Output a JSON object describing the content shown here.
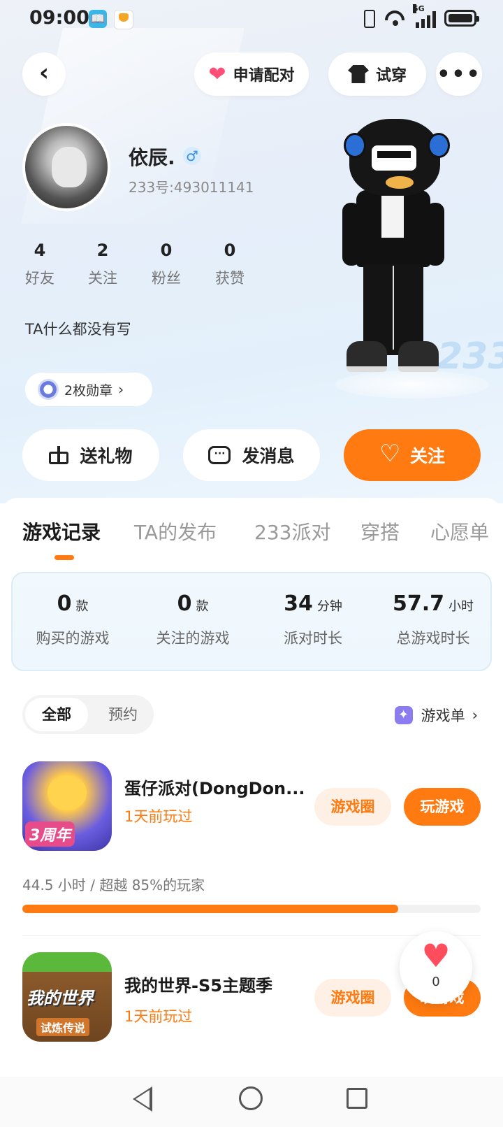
{
  "status_bar": {
    "time": "09:00",
    "network": "5G"
  },
  "header": {
    "pair_label": "申请配对",
    "try_label": "试穿",
    "more_label": "•••"
  },
  "profile": {
    "name": "依辰.",
    "gender_symbol": "♂",
    "id_text": "233号:493011141",
    "stats": [
      {
        "value": "4",
        "label": "好友"
      },
      {
        "value": "2",
        "label": "关注"
      },
      {
        "value": "0",
        "label": "粉丝"
      },
      {
        "value": "0",
        "label": "获赞"
      }
    ],
    "bio": "TA什么都没有写",
    "badges_label": "2枚勋章",
    "watermark": "233"
  },
  "actions": {
    "gift_label": "送礼物",
    "message_label": "发消息",
    "follow_label": "关注"
  },
  "tabs": [
    "游戏记录",
    "TA的发布",
    "233派对",
    "穿搭",
    "心愿单"
  ],
  "summary": [
    {
      "value": "0",
      "unit": "款",
      "label": "购买的游戏"
    },
    {
      "value": "0",
      "unit": "款",
      "label": "关注的游戏"
    },
    {
      "value": "34",
      "unit": "分钟",
      "label": "派对时长"
    },
    {
      "value": "57.7",
      "unit": "小时",
      "label": "总游戏时长"
    }
  ],
  "filters": {
    "all": "全部",
    "reserved": "预约"
  },
  "gamelist_label": "游戏单",
  "games": [
    {
      "title": "蛋仔派对(DongDon...",
      "last_played": "1天前玩过",
      "circle_label": "游戏圈",
      "play_label": "玩游戏",
      "playtime": "44.5 小时 / 超越 85%的玩家",
      "progress": 0.82,
      "icon_text": "3周年"
    },
    {
      "title": "我的世界-S5主题季",
      "last_played": "1天前玩过",
      "circle_label": "游戏圈",
      "play_label": "玩游戏",
      "icon_title": "我的世界",
      "icon_sub": "试炼传说"
    }
  ],
  "like_float": {
    "count": "0"
  },
  "colors": {
    "accent": "#ff7a10",
    "heart": "#ff4d5e",
    "accent_light": "#fff0e6"
  }
}
